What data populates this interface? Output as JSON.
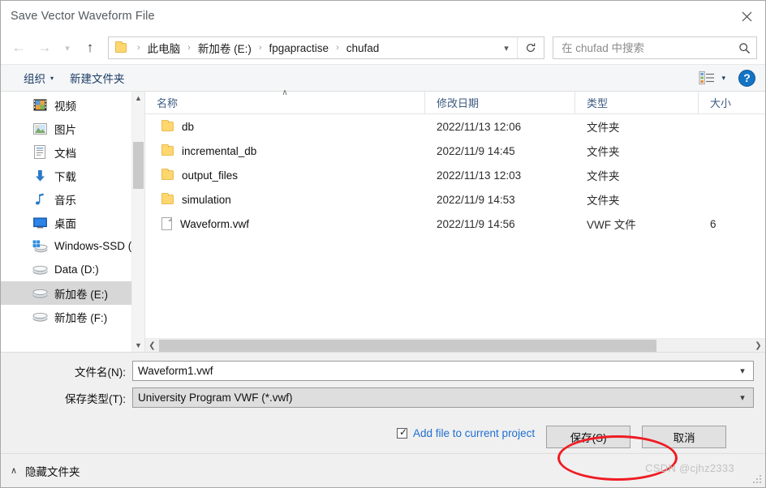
{
  "window": {
    "title": "Save Vector Waveform File",
    "close_icon": "close-icon"
  },
  "nav": {
    "back_icon": "arrow-left-icon",
    "forward_icon": "arrow-right-icon",
    "recent_icon": "chevron-down-icon",
    "up_icon": "arrow-up-icon",
    "refresh_icon": "refresh-icon",
    "dropdown_icon": "chevron-down-icon"
  },
  "breadcrumb": {
    "folder_icon": "folder-icon",
    "separator": "›",
    "items": [
      "此电脑",
      "新加卷 (E:)",
      "fpgapractise",
      "chufad"
    ]
  },
  "search": {
    "placeholder": "在 chufad 中搜索",
    "value": "",
    "icon": "search-icon"
  },
  "toolbar": {
    "organize_label": "组织",
    "organize_caret": "▾",
    "new_folder_label": "新建文件夹",
    "view_icon": "list-view-icon",
    "view_caret": "▾",
    "help_label": "?",
    "help_icon": "help-icon"
  },
  "sidebar": {
    "scroll_up_icon": "chevron-up-icon",
    "scroll_down_icon": "chevron-down-icon",
    "items": [
      {
        "label": "视频",
        "icon": "videos-icon",
        "selected": false
      },
      {
        "label": "图片",
        "icon": "pictures-icon",
        "selected": false
      },
      {
        "label": "文档",
        "icon": "documents-icon",
        "selected": false
      },
      {
        "label": "下载",
        "icon": "downloads-icon",
        "selected": false
      },
      {
        "label": "音乐",
        "icon": "music-icon",
        "selected": false
      },
      {
        "label": "桌面",
        "icon": "desktop-icon",
        "selected": false
      },
      {
        "label": "Windows-SSD (",
        "icon": "windows-drive-icon",
        "selected": false
      },
      {
        "label": "Data (D:)",
        "icon": "drive-icon",
        "selected": false
      },
      {
        "label": "新加卷 (E:)",
        "icon": "drive-icon",
        "selected": true
      },
      {
        "label": "新加卷 (F:)",
        "icon": "drive-icon",
        "selected": false
      }
    ]
  },
  "filelist": {
    "columns": [
      "名称",
      "修改日期",
      "类型",
      "大小"
    ],
    "sort_column": "名称",
    "sort_indicator": "∧",
    "rows": [
      {
        "name": "db",
        "icon": "folder-icon",
        "date": "2022/11/13 12:06",
        "type": "文件夹",
        "size": ""
      },
      {
        "name": "incremental_db",
        "icon": "folder-icon",
        "date": "2022/11/9 14:45",
        "type": "文件夹",
        "size": ""
      },
      {
        "name": "output_files",
        "icon": "folder-icon",
        "date": "2022/11/13 12:03",
        "type": "文件夹",
        "size": ""
      },
      {
        "name": "simulation",
        "icon": "folder-icon",
        "date": "2022/11/9 14:53",
        "type": "文件夹",
        "size": ""
      },
      {
        "name": "Waveform.vwf",
        "icon": "file-icon",
        "date": "2022/11/9 14:56",
        "type": "VWF 文件",
        "size": "6"
      }
    ],
    "hscroll_left_icon": "chevron-left-icon",
    "hscroll_right_icon": "chevron-right-icon"
  },
  "form": {
    "filename_label": "文件名(N):",
    "filename_value": "Waveform1.vwf",
    "filetype_label": "保存类型(T):",
    "filetype_value": "University Program VWF (*.vwf)"
  },
  "actions": {
    "checkbox_label": "Add file to current project",
    "checkbox_checked": true,
    "checkbox_tick": "✓",
    "save_label": "保存(S)",
    "cancel_label": "取消"
  },
  "bottom": {
    "hide_folders_label": "隐藏文件夹",
    "hide_folders_caret": "∧"
  },
  "annotations": {
    "highlight_color": "#ee1c24",
    "watermark": "CSDN @cjhz2333"
  }
}
